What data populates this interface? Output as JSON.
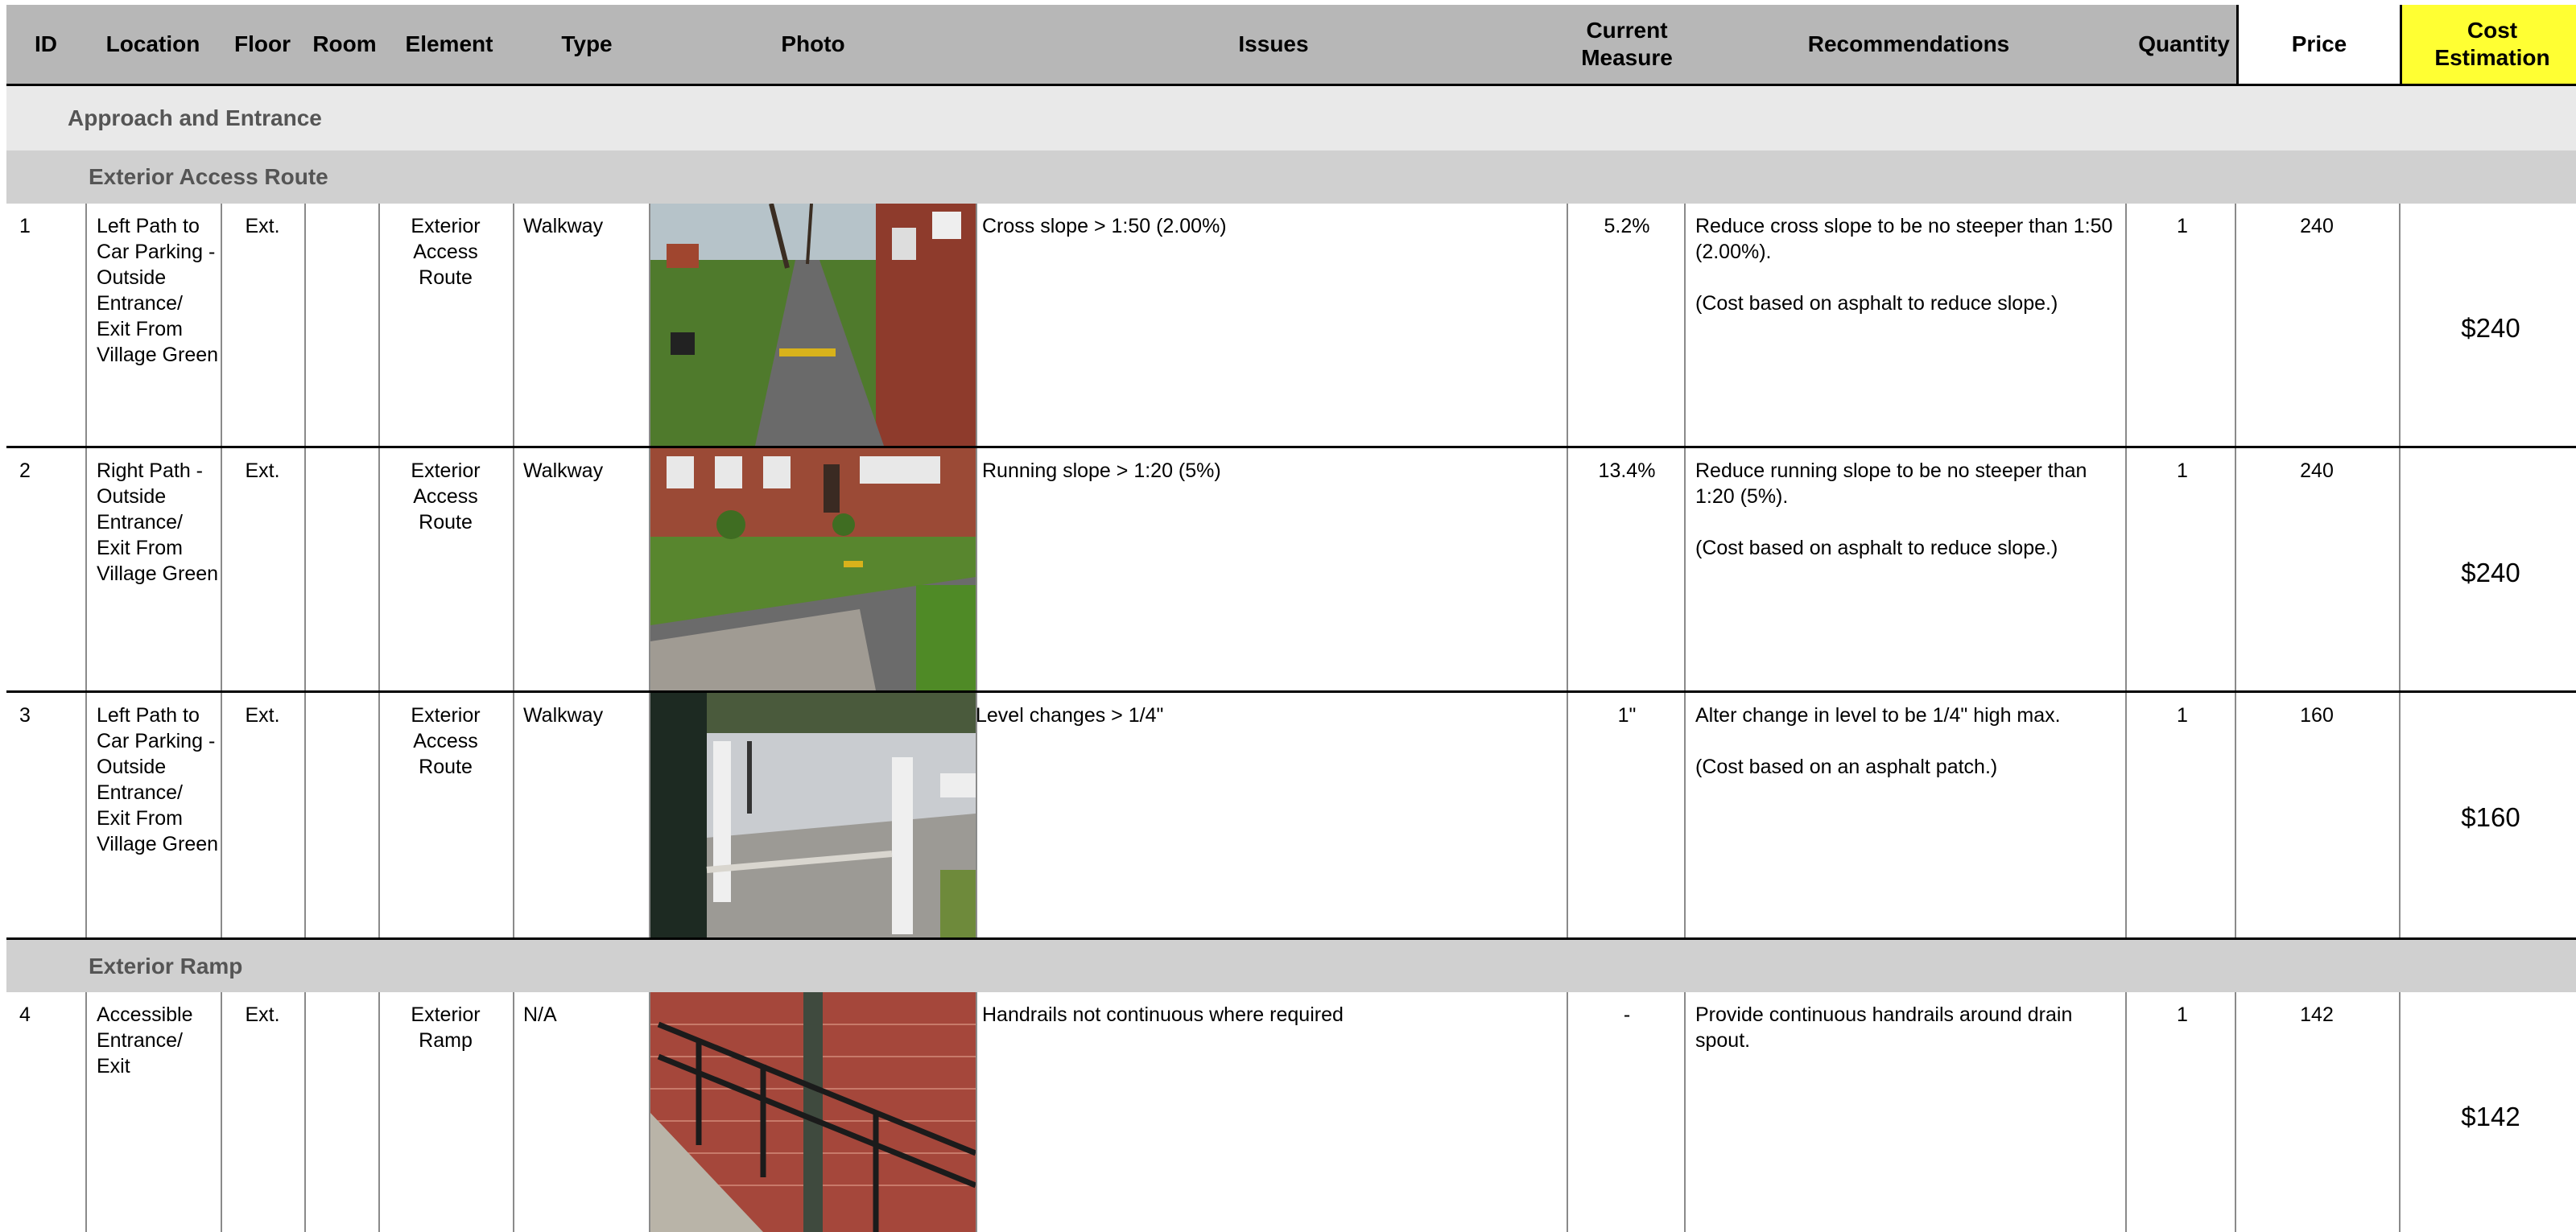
{
  "header": {
    "id": "ID",
    "location": "Location",
    "floor": "Floor",
    "room": "Room",
    "element": "Element",
    "type": "Type",
    "photo": "Photo",
    "issues": "Issues",
    "current_measure": "Current\nMeasure",
    "recommendations": "Recommendations",
    "quantity": "Quantity",
    "price": "Price",
    "cost_estimation": "Cost\nEstimation"
  },
  "sections": {
    "approach": "Approach and Entrance",
    "exterior_access_route": "Exterior Access Route",
    "exterior_ramp": "Exterior Ramp"
  },
  "colors": {
    "header_bg": "#b7b7b7",
    "cost_header_bg": "#ffff33",
    "section_bg_l1": "#e9e9e9",
    "section_bg_l2": "#d0d0d0"
  },
  "rows": [
    {
      "id": "1",
      "location": "Left Path to\nCar Parking -\nOutside\nEntrance/\nExit From\nVillage Green",
      "floor": "Ext.",
      "room": "",
      "element": "Exterior\nAccess\nRoute",
      "type": "Walkway",
      "photo_icon": "walkway-photo",
      "issue": "Cross slope > 1:50 (2.00%)",
      "current_measure": "5.2%",
      "recommendation": "Reduce cross slope to be no steeper than 1:50\n(2.00%).\n\n(Cost based on asphalt to reduce slope.)",
      "quantity": "1",
      "price": "240",
      "cost": "$240"
    },
    {
      "id": "2",
      "location": "Right Path -\nOutside\nEntrance/\nExit From\nVillage Green",
      "floor": "Ext.",
      "room": "",
      "element": "Exterior\nAccess\nRoute",
      "type": "Walkway",
      "photo_icon": "path-photo",
      "issue": "Running slope > 1:20 (5%)",
      "current_measure": "13.4%",
      "recommendation": "Reduce running slope to be no steeper than\n1:20 (5%).\n\n(Cost based on asphalt to reduce slope.)",
      "quantity": "1",
      "price": "240",
      "cost": "$240"
    },
    {
      "id": "3",
      "location": "Left Path to\nCar Parking -\nOutside\nEntrance/\nExit From\nVillage Green",
      "floor": "Ext.",
      "room": "",
      "element": "Exterior\nAccess\nRoute",
      "type": "Walkway",
      "photo_icon": "level-change-photo",
      "issue": "Level changes > 1/4\"",
      "current_measure": "1\"",
      "recommendation": "Alter change in level to be 1/4\" high max.\n\n(Cost based on an asphalt patch.)",
      "quantity": "1",
      "price": "160",
      "cost": "$160"
    },
    {
      "id": "4",
      "location": "Accessible\nEntrance/\nExit",
      "floor": "Ext.",
      "room": "",
      "element": "Exterior\nRamp",
      "type": "N/A",
      "photo_icon": "ramp-handrail-photo",
      "issue": "Handrails not continuous where required",
      "current_measure": "-",
      "recommendation": "Provide continuous handrails around drain\nspout.",
      "quantity": "1",
      "price": "142",
      "cost": "$142"
    }
  ]
}
